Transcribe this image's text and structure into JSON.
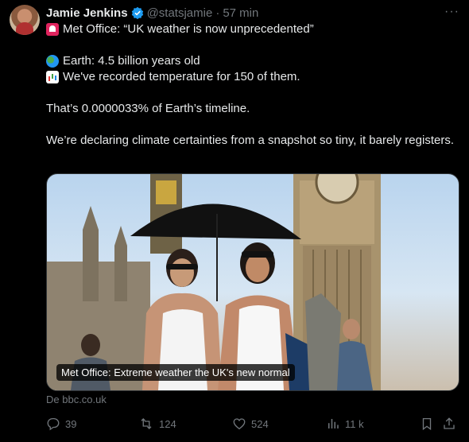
{
  "tweet": {
    "author_name": "Jamie Jenkins",
    "handle": "@statsjamie",
    "separator": "·",
    "time": "57 min",
    "more": "···",
    "lines": {
      "headline": "Met Office: “UK weather is now unprecedented”",
      "earth": "Earth: 4.5 billion years old",
      "recorded": "We've recorded temperature for 150 of them.",
      "fraction": "That’s 0.0000033% of Earth’s timeline.",
      "conclusion": "We’re declaring climate certainties from a snapshot so tiny, it barely registers."
    },
    "emojis": [
      "siren-emoji",
      "globe-emoji",
      "bar-chart-emoji"
    ]
  },
  "media": {
    "caption": "Met Office: Extreme weather the UK's new normal",
    "source": "De bbc.co.uk"
  },
  "actions": {
    "replies": "39",
    "reposts": "124",
    "likes": "524",
    "views": "11 k"
  },
  "colors": {
    "background": "#000000",
    "text": "#e7e9ea",
    "muted": "#71767b",
    "verified": "#1d9bf0"
  }
}
